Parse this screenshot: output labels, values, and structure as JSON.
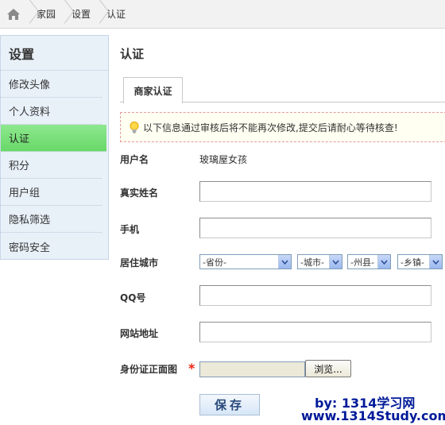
{
  "breadcrumb": {
    "items": [
      "家园",
      "设置",
      "认证"
    ]
  },
  "sidebar": {
    "title": "设置",
    "items": [
      {
        "label": "修改头像",
        "active": false
      },
      {
        "label": "个人资料",
        "active": false
      },
      {
        "label": "认证",
        "active": true
      },
      {
        "label": "积分",
        "active": false
      },
      {
        "label": "用户组",
        "active": false
      },
      {
        "label": "隐私筛选",
        "active": false
      },
      {
        "label": "密码安全",
        "active": false
      }
    ]
  },
  "main": {
    "title": "认证",
    "tab": "商家认证",
    "notice": "以下信息通过审核后将不能再次修改,提交后请耐心等待核查!"
  },
  "form": {
    "username_label": "用户名",
    "username_value": "玻璃屋女孩",
    "realname_label": "真实姓名",
    "realname_value": "",
    "phone_label": "手机",
    "phone_value": "",
    "city_label": "居住城市",
    "province_selected": "-省份-",
    "city_selected": "-城市-",
    "county_selected": "-州县-",
    "town_selected": "-乡镇-",
    "qq_label": "QQ号",
    "qq_value": "",
    "website_label": "网站地址",
    "website_value": "",
    "idcard_label": "身份证正面图",
    "required_mark": "*",
    "browse_label": "浏览...",
    "save_label": "保存"
  },
  "watermark": {
    "line1": "by: 1314学习网",
    "line2": "www.1314Study.com"
  },
  "colors": {
    "active_nav": "#7ee07e",
    "sidebar_bg": "#e8f0f8",
    "required": "#e21111",
    "watermark": "#001a99"
  }
}
